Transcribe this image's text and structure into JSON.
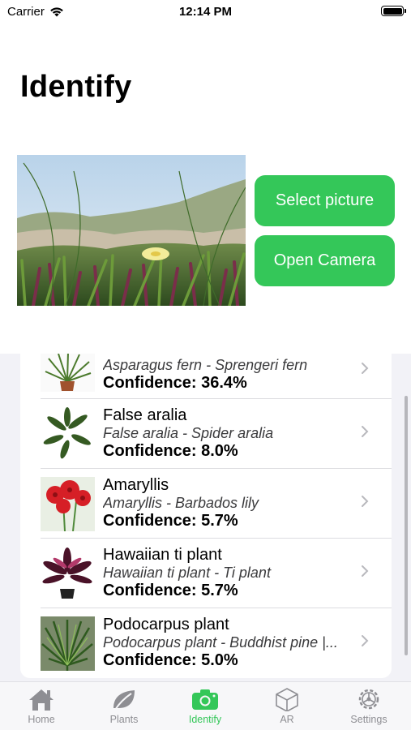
{
  "status_bar": {
    "carrier": "Carrier",
    "time": "12:14 PM"
  },
  "page": {
    "title": "Identify"
  },
  "buttons": {
    "select_picture": "Select picture",
    "open_camera": "Open Camera"
  },
  "results": [
    {
      "name": "",
      "subtitle": "Asparagus fern - Sprengeri fern",
      "confidence": "Confidence: 36.4%"
    },
    {
      "name": "False aralia",
      "subtitle": "False aralia - Spider aralia",
      "confidence": "Confidence: 8.0%"
    },
    {
      "name": "Amaryllis",
      "subtitle": "Amaryllis - Barbados lily",
      "confidence": "Confidence: 5.7%"
    },
    {
      "name": "Hawaiian ti plant",
      "subtitle": "Hawaiian ti plant - Ti plant",
      "confidence": "Confidence: 5.7%"
    },
    {
      "name": "Podocarpus plant",
      "subtitle": "Podocarpus plant - Buddhist pine |...",
      "confidence": "Confidence: 5.0%"
    }
  ],
  "tabs": [
    {
      "label": "Home",
      "icon": "house-icon"
    },
    {
      "label": "Plants",
      "icon": "leaf-icon"
    },
    {
      "label": "Identify",
      "icon": "camera-icon",
      "active": true
    },
    {
      "label": "AR",
      "icon": "cube-icon"
    },
    {
      "label": "Settings",
      "icon": "gear-icon"
    }
  ],
  "colors": {
    "accent": "#34c759",
    "inactive": "#8e8e93"
  }
}
